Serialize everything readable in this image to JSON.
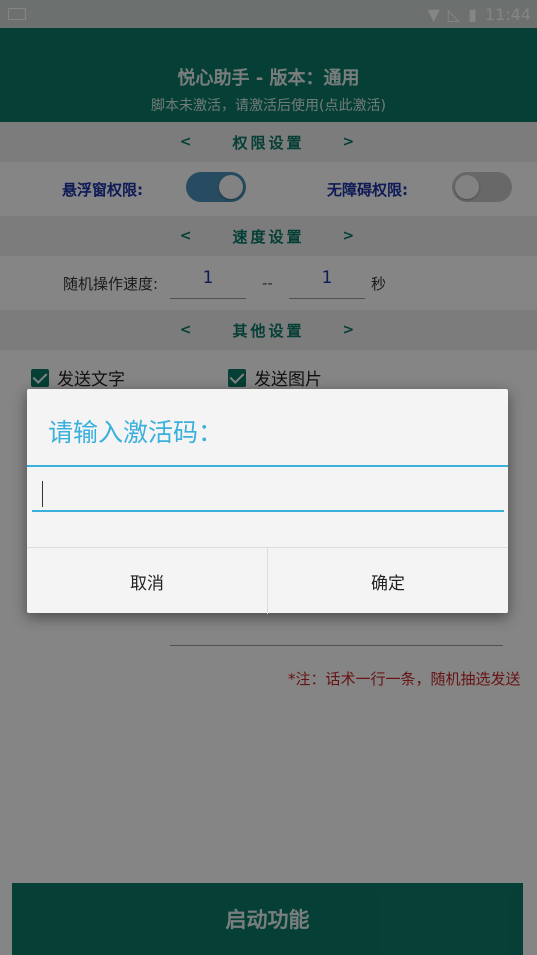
{
  "status_bar": {
    "time": "11:44"
  },
  "header": {
    "title": "悦心助手 - 版本：通用",
    "subtitle": "脚本未激活，请激活后使用(点此激活)"
  },
  "sections": {
    "permission": {
      "label": "权限设置",
      "prev": "<",
      "next": ">"
    },
    "speed": {
      "label": "速度设置",
      "prev": "<",
      "next": ">"
    },
    "other": {
      "label": "其他设置",
      "prev": "<",
      "next": ">"
    }
  },
  "permissions": {
    "floating": {
      "label": "悬浮窗权限:",
      "on": true
    },
    "accessibility": {
      "label": "无障碍权限:",
      "on": false
    }
  },
  "speed": {
    "label": "随机操作速度:",
    "min": "1",
    "dash": "--",
    "max": "1",
    "unit": "秒"
  },
  "options": {
    "send_text": "发送文字",
    "send_image": "发送图片"
  },
  "note": "*注：话术一行一条，随机抽选发送",
  "start_button": "启动功能",
  "dialog": {
    "title": "请输入激活码：",
    "input_value": "",
    "cancel": "取消",
    "confirm": "确定"
  },
  "colors": {
    "primary": "#0b7a67",
    "accent": "#3ab0dc",
    "warning": "#c62828",
    "label_blue": "#1d35a6"
  }
}
